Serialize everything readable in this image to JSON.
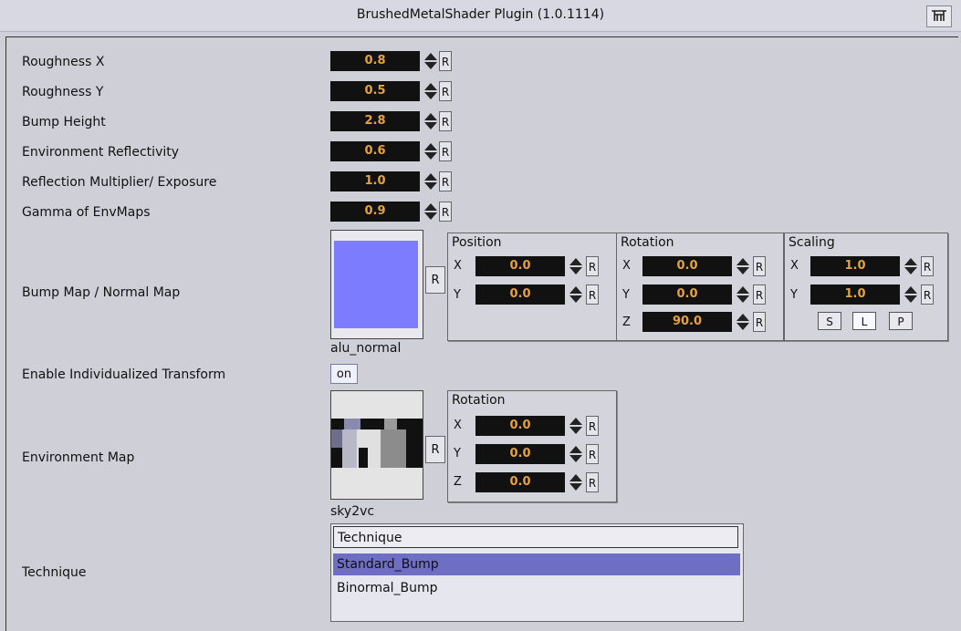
{
  "window": {
    "title": "BrushedMetalShader Plugin (1.0.1114)"
  },
  "params": [
    {
      "label": "Roughness X",
      "value": "0.8"
    },
    {
      "label": "Roughness Y",
      "value": "0.5"
    },
    {
      "label": "Bump Height",
      "value": "2.8"
    },
    {
      "label": "Environment Reflectivity",
      "value": "0.6"
    },
    {
      "label": "Reflection Multiplier/ Exposure",
      "value": "1.0"
    },
    {
      "label": "Gamma of EnvMaps",
      "value": "0.9"
    }
  ],
  "reset_label": "R",
  "bump_map": {
    "label": "Bump Map / Normal Map",
    "filename": "alu_normal",
    "thumb_color": "#7c7cff",
    "position": {
      "title": "Position",
      "axes": [
        "X",
        "Y"
      ],
      "values": [
        "0.0",
        "0.0"
      ]
    },
    "rotation": {
      "title": "Rotation",
      "axes": [
        "X",
        "Y",
        "Z"
      ],
      "values": [
        "0.0",
        "0.0",
        "90.0"
      ]
    },
    "scaling": {
      "title": "Scaling",
      "axes": [
        "X",
        "Y"
      ],
      "values": [
        "1.0",
        "1.0"
      ],
      "modes": [
        "S",
        "L",
        "P"
      ],
      "active_mode": "L"
    }
  },
  "transform": {
    "label": "Enable Individualized Transform",
    "value": "on"
  },
  "env_map": {
    "label": "Environment Map",
    "filename": "sky2vc",
    "rotation": {
      "title": "Rotation",
      "axes": [
        "X",
        "Y",
        "Z"
      ],
      "values": [
        "0.0",
        "0.0",
        "0.0"
      ]
    }
  },
  "technique": {
    "label": "Technique",
    "header": "Technique",
    "items": [
      "Standard_Bump",
      "Binormal_Bump"
    ],
    "selected": "Standard_Bump"
  }
}
